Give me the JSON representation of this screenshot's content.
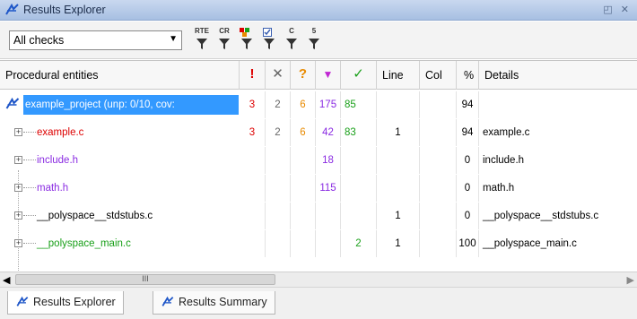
{
  "window": {
    "title": "Results Explorer",
    "controls": "◰ ✕"
  },
  "toolbar": {
    "filter_select": "All checks",
    "filters": [
      {
        "label": "RTE"
      },
      {
        "label": "CR"
      },
      {
        "label": ""
      },
      {
        "label": ""
      },
      {
        "label": "C"
      },
      {
        "label": "5"
      }
    ]
  },
  "table": {
    "headers": {
      "name": "Procedural entities",
      "red": "!",
      "gray": "✕",
      "orange": "?",
      "purple": "▼",
      "green": "✓",
      "line": "Line",
      "col": "Col",
      "pct": "%",
      "details": "Details"
    },
    "rows": [
      {
        "name": "example_project (unp: 0/10, cov:",
        "red": "3",
        "gray": "2",
        "orange": "6",
        "purple": "175",
        "green": "85",
        "line": "",
        "col": "",
        "pct": "94",
        "details": "",
        "color": "#1a1a1a"
      },
      {
        "name": "example.c",
        "red": "3",
        "gray": "2",
        "orange": "6",
        "purple": "42",
        "green": "83",
        "line": "1",
        "col": "",
        "pct": "94",
        "details": "example.c",
        "color": "#dd0000"
      },
      {
        "name": "include.h",
        "red": "",
        "gray": "",
        "orange": "",
        "purple": "18",
        "green": "",
        "line": "",
        "col": "",
        "pct": "0",
        "details": "include.h",
        "color": "#8a2be2"
      },
      {
        "name": "math.h",
        "red": "",
        "gray": "",
        "orange": "",
        "purple": "115",
        "green": "",
        "line": "",
        "col": "",
        "pct": "0",
        "details": "math.h",
        "color": "#8a2be2"
      },
      {
        "name": "__polyspace__stdstubs.c",
        "red": "",
        "gray": "",
        "orange": "",
        "purple": "",
        "green": "",
        "line": "1",
        "col": "",
        "pct": "0",
        "details": "__polyspace__stdstubs.c",
        "color": "#000000"
      },
      {
        "name": "__polyspace_main.c",
        "red": "",
        "gray": "",
        "orange": "",
        "purple": "",
        "green": "2",
        "line": "1",
        "col": "",
        "pct": "100",
        "details": "__polyspace_main.c",
        "color": "#1aa01a"
      }
    ]
  },
  "scrollbar": {
    "grip": "III"
  },
  "tabs": [
    {
      "label": "Results Explorer"
    },
    {
      "label": "Results Summary"
    }
  ],
  "colors": {
    "red": "#dd0000",
    "gray": "#666666",
    "orange": "#e88a00",
    "purple": "#8a2be2",
    "green": "#1aa01a",
    "selection": "#3399ff"
  }
}
